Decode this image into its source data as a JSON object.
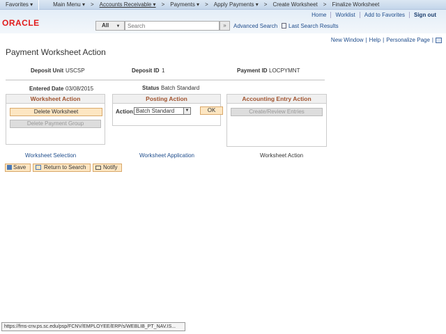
{
  "nav": {
    "favorites": "Favorites ▾",
    "main_menu": "Main Menu ▾",
    "breadcrumbs": [
      "Accounts Receivable ▾",
      "Payments ▾",
      "Apply Payments ▾",
      "Create Worksheet",
      "Finalize Worksheet"
    ],
    "sep": ">"
  },
  "header": {
    "logo": "ORACLE",
    "links": [
      "Home",
      "Worklist",
      "Add to Favorites",
      "Sign out"
    ],
    "search_scope": "All",
    "search_placeholder": "Search",
    "search_go": "»",
    "advanced_search": "Advanced Search",
    "last_results": "Last Search Results"
  },
  "page_links": [
    "New Window",
    "Help",
    "Personalize Page"
  ],
  "title": "Payment Worksheet Action",
  "fields": {
    "deposit_unit_label": "Deposit Unit",
    "deposit_unit": "USCSP",
    "deposit_id_label": "Deposit ID",
    "deposit_id": "1",
    "payment_id_label": "Payment ID",
    "payment_id": "LOCPYMNT",
    "entered_date_label": "Entered Date",
    "entered_date": "03/08/2015",
    "status_label": "Status",
    "status": "Batch Standard"
  },
  "worksheet_action": {
    "title": "Worksheet Action",
    "delete_ws": "Delete Worksheet",
    "delete_pg": "Delete Payment Group"
  },
  "posting_action": {
    "title": "Posting Action",
    "action_label": "Action:",
    "action_value": "Batch Standard",
    "ok": "OK"
  },
  "accounting": {
    "title": "Accounting Entry Action",
    "create": "Create/Review Entries"
  },
  "bottom_links": {
    "selection": "Worksheet Selection",
    "application": "Worksheet Application",
    "action": "Worksheet Action"
  },
  "toolbar": {
    "save": "Save",
    "return": "Return to Search",
    "notify": "Notify"
  },
  "status_bar": "https://fms-cnv.ps.sc.edu/psp/FCNV/EMPLOYEE/ERP/s/WEBLIB_PT_NAV.IS..."
}
